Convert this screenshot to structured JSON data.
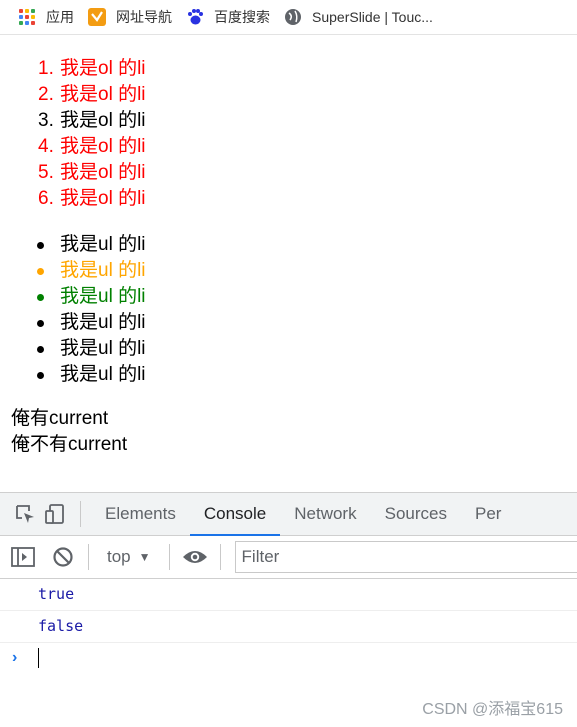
{
  "bookmarks": [
    {
      "label": "应用",
      "icon": "apps-grid-icon"
    },
    {
      "label": "网址导航",
      "icon": "navigation-icon"
    },
    {
      "label": "百度搜索",
      "icon": "baidu-paw-icon"
    },
    {
      "label": "SuperSlide | Touc...",
      "icon": "globe-icon"
    }
  ],
  "ol_items": [
    {
      "num": "1.",
      "text": "我是ol 的li",
      "color": "#ff0000"
    },
    {
      "num": "2.",
      "text": "我是ol 的li",
      "color": "#ff0000"
    },
    {
      "num": "3.",
      "text": "我是ol 的li",
      "color": "#000000"
    },
    {
      "num": "4.",
      "text": "我是ol 的li",
      "color": "#ff0000"
    },
    {
      "num": "5.",
      "text": "我是ol 的li",
      "color": "#ff0000"
    },
    {
      "num": "6.",
      "text": "我是ol 的li",
      "color": "#ff0000"
    }
  ],
  "ul_items": [
    {
      "text": "我是ul 的li",
      "color": "#000000"
    },
    {
      "text": "我是ul 的li",
      "color": "#ffa500"
    },
    {
      "text": "我是ul 的li",
      "color": "#008000"
    },
    {
      "text": "我是ul 的li",
      "color": "#000000"
    },
    {
      "text": "我是ul 的li",
      "color": "#000000"
    },
    {
      "text": "我是ul 的li",
      "color": "#000000"
    }
  ],
  "divs": [
    "俺有current",
    "俺不有current"
  ],
  "devtools": {
    "tabs": [
      "Elements",
      "Console",
      "Network",
      "Sources",
      "Per"
    ],
    "active_tab": "Console",
    "context": "top",
    "filter_placeholder": "Filter",
    "output": [
      "true",
      "false"
    ]
  },
  "watermark": "CSDN @添福宝615"
}
